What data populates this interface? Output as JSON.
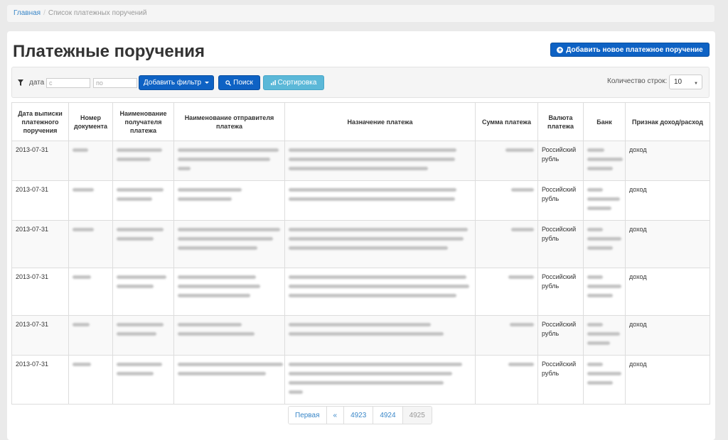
{
  "breadcrumb": {
    "home": "Главная",
    "separator": "/",
    "current": "Список платежных поручений"
  },
  "page": {
    "title": "Платежные поручения",
    "add_button": "Добавить новое платежное поручение"
  },
  "filters": {
    "date_label": "дата",
    "from_placeholder": "с",
    "to_placeholder": "по",
    "add_filter": "Добавить фильтр",
    "search": "Поиск",
    "sort": "Сортировка",
    "rows_label": "Количество строк:",
    "rows_value": "10"
  },
  "table": {
    "headers": [
      "Дата выписки платежного поручения",
      "Номер документа",
      "Наименование получателя платежа",
      "Наименование отправителя платежа",
      "Назначение платежа",
      "Сумма платежа",
      "Валюта платежа",
      "Банк",
      "Признак доход/расход"
    ],
    "rows": [
      {
        "date": "2013-07-31",
        "currency": "Российский рубль",
        "sign": "доход"
      },
      {
        "date": "2013-07-31",
        "currency": "Российский рубль",
        "sign": "доход"
      },
      {
        "date": "2013-07-31",
        "currency": "Российский рубль",
        "sign": "доход"
      },
      {
        "date": "2013-07-31",
        "currency": "Российский рубль",
        "sign": "доход"
      },
      {
        "date": "2013-07-31",
        "currency": "Российский рубль",
        "sign": "доход"
      },
      {
        "date": "2013-07-31",
        "currency": "Российский рубль",
        "sign": "доход"
      }
    ]
  },
  "pagination": {
    "first": "Первая",
    "prev": "«",
    "pages": [
      "4923",
      "4924",
      "4925"
    ]
  },
  "colors": {
    "primary": "#0e62c4",
    "info": "#5bb8d8",
    "link": "#3a87c8"
  }
}
